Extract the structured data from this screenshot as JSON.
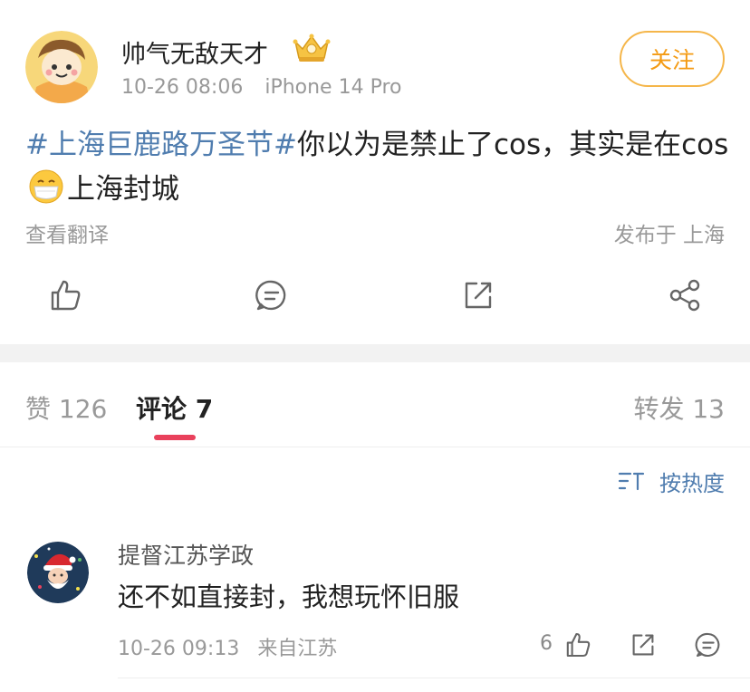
{
  "post": {
    "username": "帅气无敌天才",
    "time": "10-26 08:06",
    "device": "iPhone 14 Pro",
    "follow_label": "关注",
    "topic": "#上海巨鹿路万圣节#",
    "text_part1": "你以为是禁止了cos，其实是在cos",
    "text_part2": "上海封城",
    "translate_label": "查看翻译",
    "location": "发布于 上海",
    "icons": [
      "like-icon",
      "comment-icon",
      "repost-icon",
      "share-icon"
    ]
  },
  "tabs": {
    "likes": "赞 126",
    "comments": "评论 7",
    "reposts": "转发 13"
  },
  "sort": {
    "label": "按热度"
  },
  "comments": [
    {
      "user": "提督江苏学政",
      "text": "还不如直接封，我想玩怀旧服",
      "time": "10-26 09:13",
      "source": "来自江苏",
      "like_count": "6"
    }
  ],
  "colors": {
    "topic": "#507daf",
    "follow": "#f49b14",
    "tab_indicator": "#e9415c",
    "muted": "#999999"
  }
}
